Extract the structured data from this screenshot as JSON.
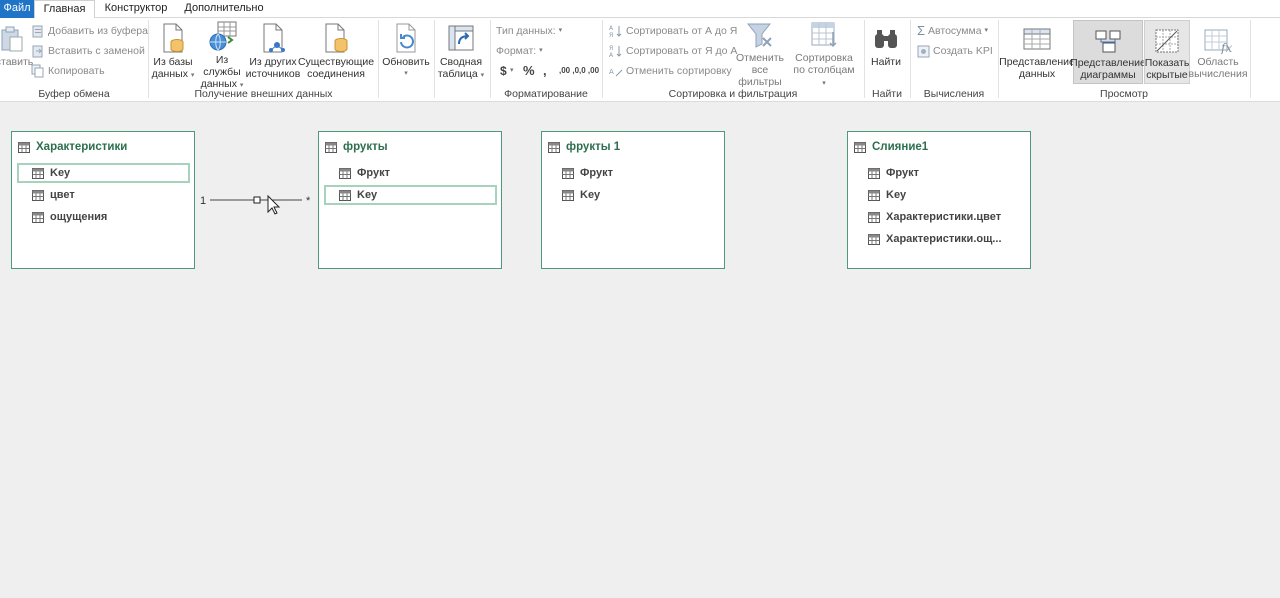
{
  "tabs": {
    "file": "Файл",
    "home": "Главная",
    "design": "Конструктор",
    "advanced": "Дополнительно"
  },
  "clipboard": {
    "paste": "Вставить",
    "add_from_clipboard": "Добавить из буфера",
    "paste_replace": "Вставить с заменой",
    "copy": "Копировать",
    "group": "Буфер обмена"
  },
  "external": {
    "from_db_1": "Из базы",
    "from_db_2": "данных",
    "from_service_1": "Из службы",
    "from_service_2": "данных",
    "from_other_1": "Из других",
    "from_other_2": "источников",
    "existing_1": "Существующие",
    "existing_2": "соединения",
    "group": "Получение внешних данных"
  },
  "refresh": {
    "label": "Обновить"
  },
  "pivot": {
    "label_1": "Сводная",
    "label_2": "таблица"
  },
  "formatting": {
    "data_type": "Тип данных:",
    "format": "Формат:",
    "dollar": "$",
    "percent": "%",
    "comma": ",",
    "inc_decimal": ",00 ,0",
    "dec_decimal": ",0 ,00",
    "group": "Форматирование"
  },
  "sort": {
    "asc": "Сортировать от А до Я",
    "desc": "Сортировать от Я до А",
    "clear_sort": "Отменить сортировку",
    "clear_filters_1": "Отменить",
    "clear_filters_2": "все фильтры",
    "by_column_1": "Сортировка",
    "by_column_2": "по столбцам",
    "group": "Сортировка и фильтрация"
  },
  "find": {
    "label": "Найти",
    "group": "Найти"
  },
  "calculations": {
    "autosum": "Автосумма",
    "create_kpi": "Создать KPI",
    "group": "Вычисления"
  },
  "view": {
    "data_view_1": "Представление",
    "data_view_2": "данных",
    "diagram_view_1": "Представление",
    "diagram_view_2": "диаграммы",
    "show_hidden_1": "Показать",
    "show_hidden_2": "скрытые",
    "calc_area_1": "Область",
    "calc_area_2": "вычисления",
    "group": "Просмотр"
  },
  "tables": [
    {
      "name": "Характеристики",
      "fields": [
        "Key",
        "цвет",
        "ощущения"
      ]
    },
    {
      "name": "фрукты",
      "fields": [
        "Фрукт",
        "Key"
      ]
    },
    {
      "name": "фрукты 1",
      "fields": [
        "Фрукт",
        "Key"
      ]
    },
    {
      "name": "Слияние1",
      "fields": [
        "Фрукт",
        "Key",
        "Характеристики.цвет",
        "Характеристики.ощ..."
      ]
    }
  ],
  "relationship": {
    "one": "1",
    "many": "*"
  },
  "colors": {
    "accent": "#1f74c8",
    "table_border": "#4c9b78",
    "table_title": "#2e6e4e",
    "selection": "#a7d3bd"
  }
}
